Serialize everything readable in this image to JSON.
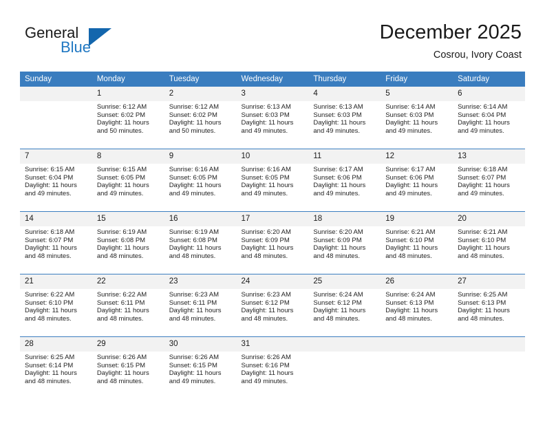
{
  "brand": {
    "name_part1": "General",
    "name_part2": "Blue",
    "flag_icon": "flag-icon",
    "accent_color": "#1366ad",
    "blue_text_color": "#1f77c2"
  },
  "header": {
    "title": "December 2025",
    "subtitle": "Cosrou, Ivory Coast"
  },
  "theme": {
    "header_row_bg": "#3a7dbf",
    "daynum_bg": "#f2f2f2",
    "grid_line": "#3a7dbf",
    "text": "#1a1a1a"
  },
  "weekday_headers": [
    "Sunday",
    "Monday",
    "Tuesday",
    "Wednesday",
    "Thursday",
    "Friday",
    "Saturday"
  ],
  "weeks": [
    [
      {
        "day": "",
        "sunrise": "",
        "sunset": "",
        "daylight_line1": "",
        "daylight_line2": ""
      },
      {
        "day": "1",
        "sunrise": "Sunrise: 6:12 AM",
        "sunset": "Sunset: 6:02 PM",
        "daylight_line1": "Daylight: 11 hours",
        "daylight_line2": "and 50 minutes."
      },
      {
        "day": "2",
        "sunrise": "Sunrise: 6:12 AM",
        "sunset": "Sunset: 6:02 PM",
        "daylight_line1": "Daylight: 11 hours",
        "daylight_line2": "and 50 minutes."
      },
      {
        "day": "3",
        "sunrise": "Sunrise: 6:13 AM",
        "sunset": "Sunset: 6:03 PM",
        "daylight_line1": "Daylight: 11 hours",
        "daylight_line2": "and 49 minutes."
      },
      {
        "day": "4",
        "sunrise": "Sunrise: 6:13 AM",
        "sunset": "Sunset: 6:03 PM",
        "daylight_line1": "Daylight: 11 hours",
        "daylight_line2": "and 49 minutes."
      },
      {
        "day": "5",
        "sunrise": "Sunrise: 6:14 AM",
        "sunset": "Sunset: 6:03 PM",
        "daylight_line1": "Daylight: 11 hours",
        "daylight_line2": "and 49 minutes."
      },
      {
        "day": "6",
        "sunrise": "Sunrise: 6:14 AM",
        "sunset": "Sunset: 6:04 PM",
        "daylight_line1": "Daylight: 11 hours",
        "daylight_line2": "and 49 minutes."
      }
    ],
    [
      {
        "day": "7",
        "sunrise": "Sunrise: 6:15 AM",
        "sunset": "Sunset: 6:04 PM",
        "daylight_line1": "Daylight: 11 hours",
        "daylight_line2": "and 49 minutes."
      },
      {
        "day": "8",
        "sunrise": "Sunrise: 6:15 AM",
        "sunset": "Sunset: 6:05 PM",
        "daylight_line1": "Daylight: 11 hours",
        "daylight_line2": "and 49 minutes."
      },
      {
        "day": "9",
        "sunrise": "Sunrise: 6:16 AM",
        "sunset": "Sunset: 6:05 PM",
        "daylight_line1": "Daylight: 11 hours",
        "daylight_line2": "and 49 minutes."
      },
      {
        "day": "10",
        "sunrise": "Sunrise: 6:16 AM",
        "sunset": "Sunset: 6:05 PM",
        "daylight_line1": "Daylight: 11 hours",
        "daylight_line2": "and 49 minutes."
      },
      {
        "day": "11",
        "sunrise": "Sunrise: 6:17 AM",
        "sunset": "Sunset: 6:06 PM",
        "daylight_line1": "Daylight: 11 hours",
        "daylight_line2": "and 49 minutes."
      },
      {
        "day": "12",
        "sunrise": "Sunrise: 6:17 AM",
        "sunset": "Sunset: 6:06 PM",
        "daylight_line1": "Daylight: 11 hours",
        "daylight_line2": "and 49 minutes."
      },
      {
        "day": "13",
        "sunrise": "Sunrise: 6:18 AM",
        "sunset": "Sunset: 6:07 PM",
        "daylight_line1": "Daylight: 11 hours",
        "daylight_line2": "and 49 minutes."
      }
    ],
    [
      {
        "day": "14",
        "sunrise": "Sunrise: 6:18 AM",
        "sunset": "Sunset: 6:07 PM",
        "daylight_line1": "Daylight: 11 hours",
        "daylight_line2": "and 48 minutes."
      },
      {
        "day": "15",
        "sunrise": "Sunrise: 6:19 AM",
        "sunset": "Sunset: 6:08 PM",
        "daylight_line1": "Daylight: 11 hours",
        "daylight_line2": "and 48 minutes."
      },
      {
        "day": "16",
        "sunrise": "Sunrise: 6:19 AM",
        "sunset": "Sunset: 6:08 PM",
        "daylight_line1": "Daylight: 11 hours",
        "daylight_line2": "and 48 minutes."
      },
      {
        "day": "17",
        "sunrise": "Sunrise: 6:20 AM",
        "sunset": "Sunset: 6:09 PM",
        "daylight_line1": "Daylight: 11 hours",
        "daylight_line2": "and 48 minutes."
      },
      {
        "day": "18",
        "sunrise": "Sunrise: 6:20 AM",
        "sunset": "Sunset: 6:09 PM",
        "daylight_line1": "Daylight: 11 hours",
        "daylight_line2": "and 48 minutes."
      },
      {
        "day": "19",
        "sunrise": "Sunrise: 6:21 AM",
        "sunset": "Sunset: 6:10 PM",
        "daylight_line1": "Daylight: 11 hours",
        "daylight_line2": "and 48 minutes."
      },
      {
        "day": "20",
        "sunrise": "Sunrise: 6:21 AM",
        "sunset": "Sunset: 6:10 PM",
        "daylight_line1": "Daylight: 11 hours",
        "daylight_line2": "and 48 minutes."
      }
    ],
    [
      {
        "day": "21",
        "sunrise": "Sunrise: 6:22 AM",
        "sunset": "Sunset: 6:10 PM",
        "daylight_line1": "Daylight: 11 hours",
        "daylight_line2": "and 48 minutes."
      },
      {
        "day": "22",
        "sunrise": "Sunrise: 6:22 AM",
        "sunset": "Sunset: 6:11 PM",
        "daylight_line1": "Daylight: 11 hours",
        "daylight_line2": "and 48 minutes."
      },
      {
        "day": "23",
        "sunrise": "Sunrise: 6:23 AM",
        "sunset": "Sunset: 6:11 PM",
        "daylight_line1": "Daylight: 11 hours",
        "daylight_line2": "and 48 minutes."
      },
      {
        "day": "24",
        "sunrise": "Sunrise: 6:23 AM",
        "sunset": "Sunset: 6:12 PM",
        "daylight_line1": "Daylight: 11 hours",
        "daylight_line2": "and 48 minutes."
      },
      {
        "day": "25",
        "sunrise": "Sunrise: 6:24 AM",
        "sunset": "Sunset: 6:12 PM",
        "daylight_line1": "Daylight: 11 hours",
        "daylight_line2": "and 48 minutes."
      },
      {
        "day": "26",
        "sunrise": "Sunrise: 6:24 AM",
        "sunset": "Sunset: 6:13 PM",
        "daylight_line1": "Daylight: 11 hours",
        "daylight_line2": "and 48 minutes."
      },
      {
        "day": "27",
        "sunrise": "Sunrise: 6:25 AM",
        "sunset": "Sunset: 6:13 PM",
        "daylight_line1": "Daylight: 11 hours",
        "daylight_line2": "and 48 minutes."
      }
    ],
    [
      {
        "day": "28",
        "sunrise": "Sunrise: 6:25 AM",
        "sunset": "Sunset: 6:14 PM",
        "daylight_line1": "Daylight: 11 hours",
        "daylight_line2": "and 48 minutes."
      },
      {
        "day": "29",
        "sunrise": "Sunrise: 6:26 AM",
        "sunset": "Sunset: 6:15 PM",
        "daylight_line1": "Daylight: 11 hours",
        "daylight_line2": "and 48 minutes."
      },
      {
        "day": "30",
        "sunrise": "Sunrise: 6:26 AM",
        "sunset": "Sunset: 6:15 PM",
        "daylight_line1": "Daylight: 11 hours",
        "daylight_line2": "and 49 minutes."
      },
      {
        "day": "31",
        "sunrise": "Sunrise: 6:26 AM",
        "sunset": "Sunset: 6:16 PM",
        "daylight_line1": "Daylight: 11 hours",
        "daylight_line2": "and 49 minutes."
      },
      {
        "day": "",
        "sunrise": "",
        "sunset": "",
        "daylight_line1": "",
        "daylight_line2": ""
      },
      {
        "day": "",
        "sunrise": "",
        "sunset": "",
        "daylight_line1": "",
        "daylight_line2": ""
      },
      {
        "day": "",
        "sunrise": "",
        "sunset": "",
        "daylight_line1": "",
        "daylight_line2": ""
      }
    ]
  ]
}
